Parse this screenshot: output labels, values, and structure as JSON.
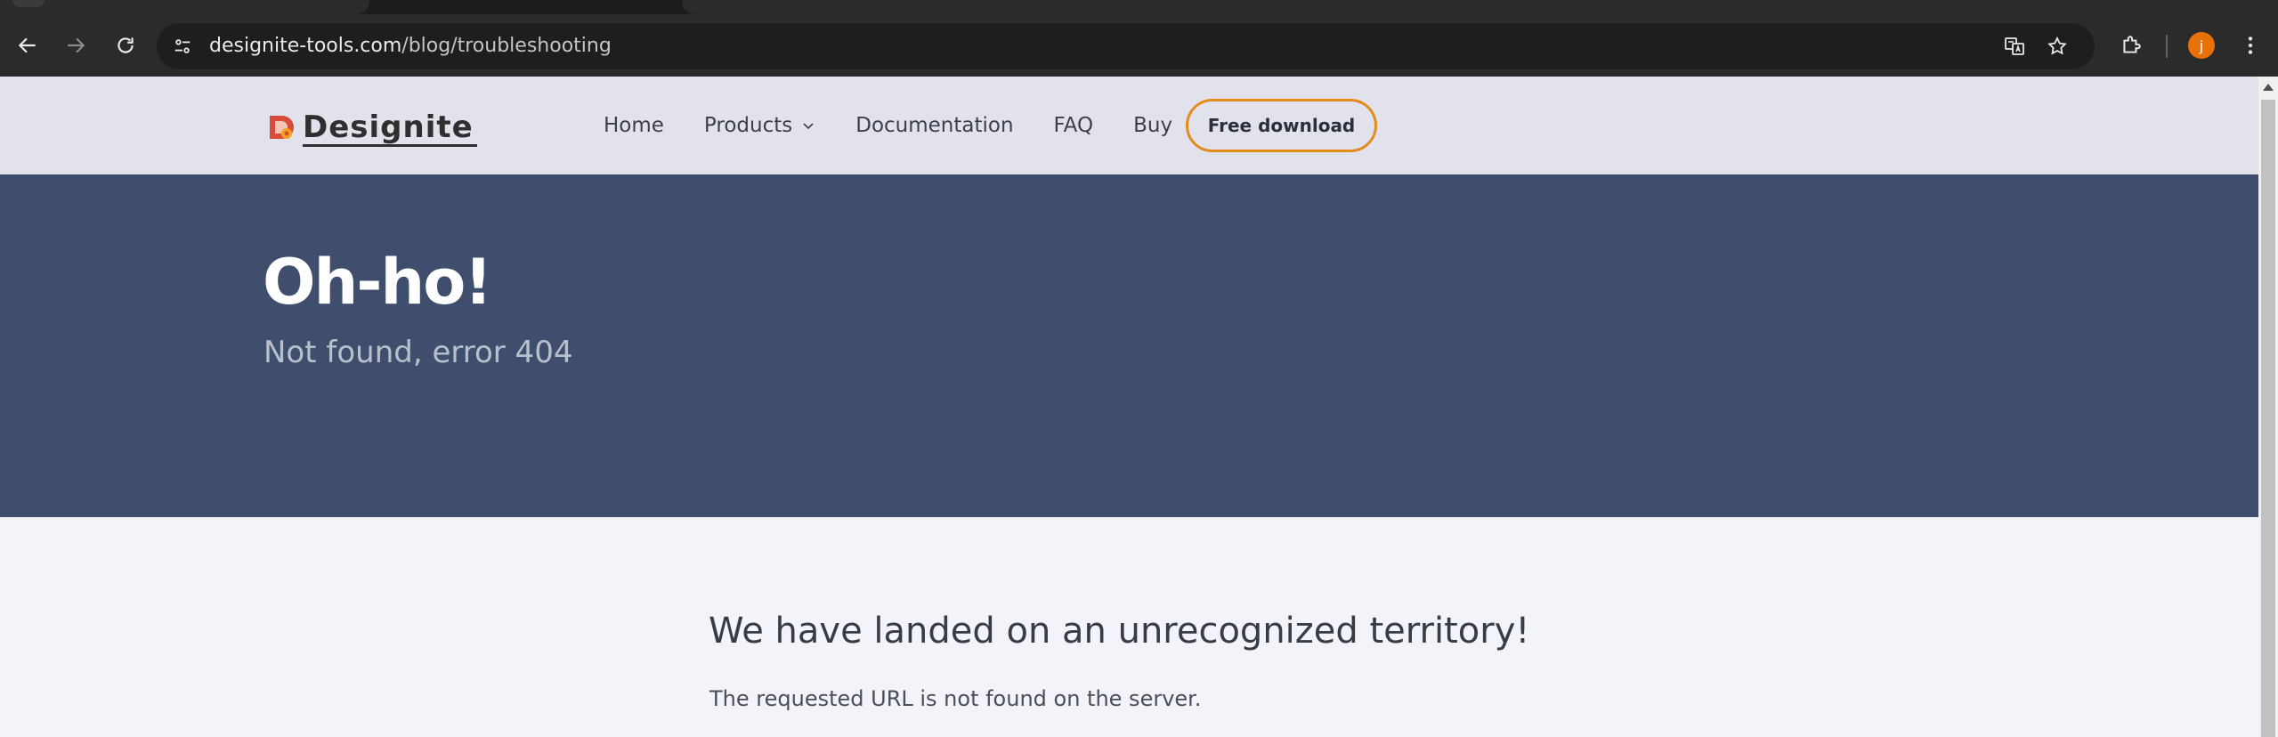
{
  "browser": {
    "url_domain": "designite-tools.com",
    "url_path": "/blog/troubleshooting",
    "profile_initial": "j",
    "accent_color": "#e8710a"
  },
  "site": {
    "logo_text": "Designite",
    "nav": {
      "items": [
        {
          "label": "Home"
        },
        {
          "label": "Products",
          "has_dropdown": true
        },
        {
          "label": "Documentation"
        },
        {
          "label": "FAQ"
        },
        {
          "label": "Buy"
        }
      ],
      "cta_label": "Free download",
      "cta_color": "#e38b1b"
    },
    "hero": {
      "title": "Oh-ho!",
      "subtitle": "Not found, error 404",
      "background": "#3e4e6c"
    },
    "content": {
      "heading": "We have landed on an unrecognized territory!",
      "message": "The requested URL is not found on the server."
    }
  }
}
